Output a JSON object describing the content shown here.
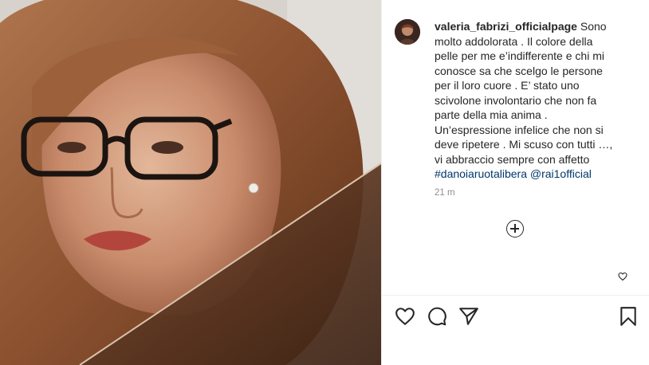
{
  "post": {
    "username": "valeria_fabrizi_officialpage",
    "caption_lines": [
      " Sono",
      "molto addolorata . Il colore della",
      "pelle per me e’indifferente e chi mi",
      "conosce sa che scelgo le persone",
      "per il loro cuore . E’ stato uno",
      "scivolone involontario che non fa",
      "parte della mia anima .",
      "Un’espressione infelice che non si",
      "deve ripetere . Mi scuso con tutti …,",
      "vi abbraccio sempre con affetto"
    ],
    "hashtag": "#danoiaruotalibera",
    "mention": "@rai1official",
    "time": "21 m"
  },
  "icons": {
    "avatar": "profile-avatar",
    "load_more": "plus-circle-icon",
    "comment_like": "heart-outline-icon",
    "like": "heart-outline-icon",
    "comment": "comment-bubble-icon",
    "share": "paper-plane-icon",
    "save": "bookmark-icon"
  },
  "colors": {
    "text": "#262626",
    "secondary": "#8e8e8e",
    "link": "#00376b",
    "divider": "#efefef"
  }
}
